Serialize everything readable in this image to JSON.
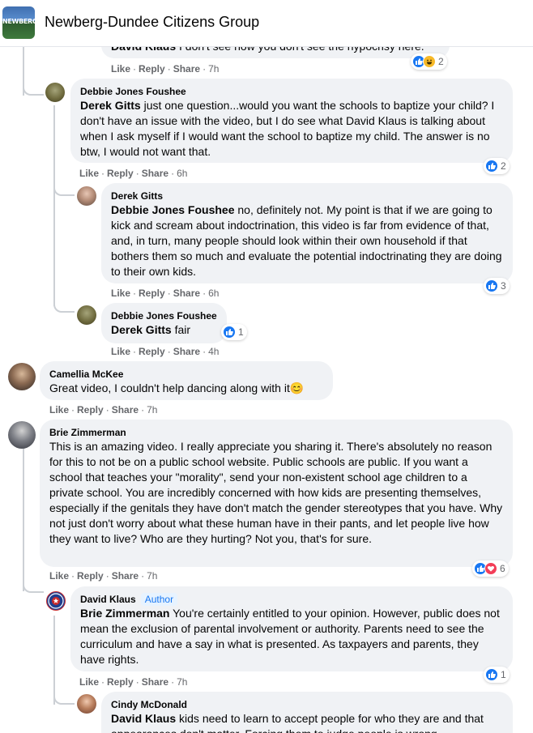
{
  "header": {
    "group_name": "Newberg-Dundee Citizens Group",
    "group_avatar_text": "NEWBERG"
  },
  "actions": {
    "like": "Like",
    "reply": "Reply",
    "share": "Share",
    "dot": "·"
  },
  "comments": [
    {
      "id": "c0",
      "author": "David Klaus",
      "mention": "David Klaus",
      "text": "I don't see how you don't see the hypocrisy here.",
      "time": "7h",
      "reactions": {
        "icons": [
          "like-icon",
          "haha-icon"
        ],
        "count": "2"
      }
    },
    {
      "id": "c1",
      "author": "Debbie Jones Foushee",
      "mention": "Derek Gitts",
      "text": "just one question...would you want the schools to baptize your child? I don't have an issue with the video, but I do see what David Klaus is talking about when I ask myself if I would want the school to baptize my child. The answer is no btw, I would not want that.",
      "time": "6h",
      "reactions": {
        "icons": [
          "like-icon"
        ],
        "count": "2"
      }
    },
    {
      "id": "c2",
      "author": "Derek Gitts",
      "mention": "Debbie Jones Foushee",
      "text": "no, definitely not. My point is that if we are going to kick and scream about indoctrination, this video is far from evidence of that, and, in turn, many people should look within their own household if that bothers them so much and evaluate the potential indoctrinating they are doing to their own kids.",
      "time": "6h",
      "reactions": {
        "icons": [
          "like-icon"
        ],
        "count": "3"
      }
    },
    {
      "id": "c3",
      "author": "Debbie Jones Foushee",
      "mention": "Derek Gitts",
      "text": "fair",
      "time": "4h",
      "reactions": {
        "icons": [
          "like-icon"
        ],
        "count": "1"
      }
    },
    {
      "id": "c4",
      "author": "Camellia McKee",
      "mention": "",
      "text": "Great video, I couldn't help dancing along with it😊",
      "time": "7h"
    },
    {
      "id": "c5",
      "author": "Brie Zimmerman",
      "mention": "",
      "text": "This is an amazing video. I really appreciate you sharing it. There's absolutely no reason for this to not be on a public school website. Public schools are public. If you want a school that teaches your \"morality\", send your non-existent school age children to a private school. You are incredibly concerned with how kids are presenting themselves, especially if the genitals they have don't match the gender stereotypes that you have. Why not just don't worry about what these human have in their pants, and let people live how they want to live? Who are they hurting? Not you, that's for sure.",
      "time": "7h",
      "reactions": {
        "icons": [
          "like-icon",
          "love-icon"
        ],
        "count": "6"
      }
    },
    {
      "id": "c6",
      "author": "David Klaus",
      "badge": "Author",
      "mention": "Brie Zimmerman",
      "text": "You're certainly entitled to your opinion. However, public does not mean the exclusion of parental involvement or authority. Parents need to see the curriculum and have a say in what is presented. As taxpayers and parents, they have rights.",
      "time": "7h",
      "reactions": {
        "icons": [
          "like-icon"
        ],
        "count": "1"
      }
    },
    {
      "id": "c7",
      "author": "Cindy McDonald",
      "mention": "David Klaus",
      "text": "kids need to learn to accept people for who they are and that appearances don't matter. Forcing them to judge people is wrong",
      "time": ""
    }
  ]
}
